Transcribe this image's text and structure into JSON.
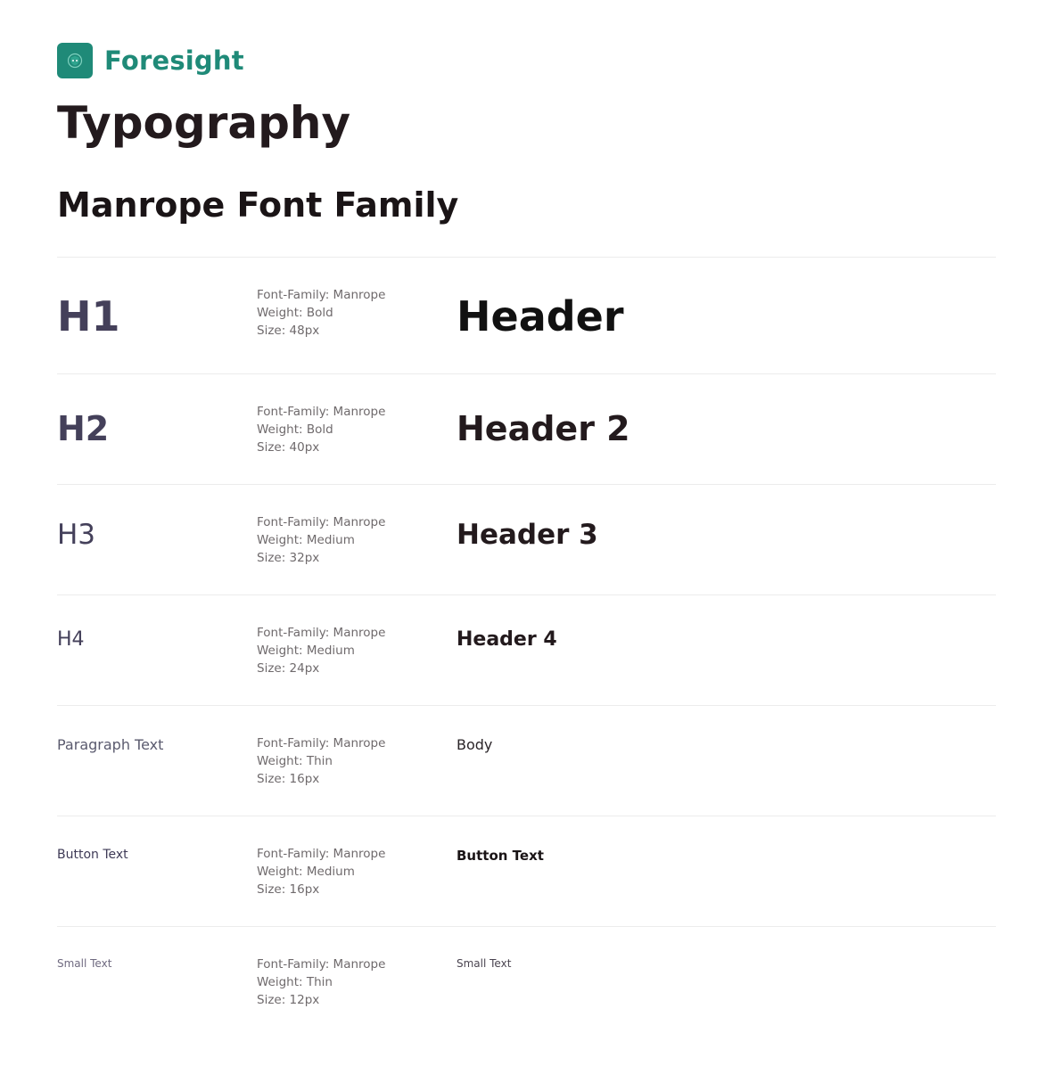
{
  "brand": {
    "name": "Foresight",
    "logo_icon": "shield-logo-icon",
    "color": "#1f8a78"
  },
  "page_title": "Typography",
  "section_title": "Manrope Font Family",
  "rows": [
    {
      "label": "H1",
      "family": "Font-Family: Manrope",
      "weight": "Weight: Bold",
      "size": "Size: 48px",
      "sample": "Header"
    },
    {
      "label": "H2",
      "family": "Font-Family: Manrope",
      "weight": "Weight: Bold",
      "size": "Size: 40px",
      "sample": "Header 2"
    },
    {
      "label": "H3",
      "family": "Font-Family: Manrope",
      "weight": "Weight: Medium",
      "size": "Size: 32px",
      "sample": "Header 3"
    },
    {
      "label": "H4",
      "family": "Font-Family: Manrope",
      "weight": "Weight: Medium",
      "size": "Size: 24px",
      "sample": "Header 4"
    },
    {
      "label": "Paragraph Text",
      "family": "Font-Family: Manrope",
      "weight": "Weight: Thin",
      "size": "Size: 16px",
      "sample": "Body"
    },
    {
      "label": "Button Text",
      "family": "Font-Family: Manrope",
      "weight": "Weight: Medium",
      "size": "Size: 16px",
      "sample": "Button Text"
    },
    {
      "label": "Small Text",
      "family": "Font-Family: Manrope",
      "weight": "Weight: Thin",
      "size": "Size: 12px",
      "sample": "Small Text"
    }
  ]
}
